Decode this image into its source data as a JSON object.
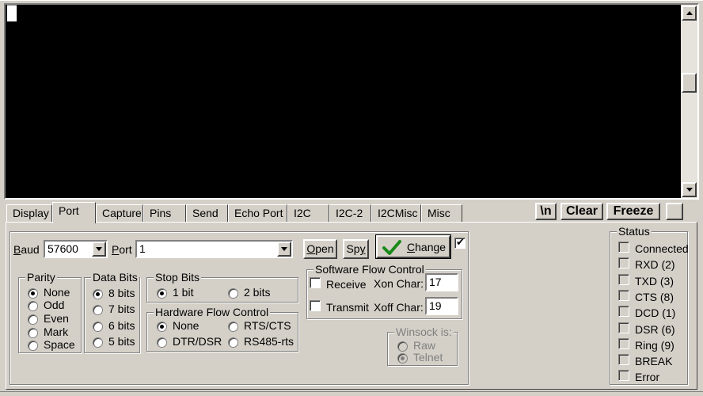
{
  "terminal": {
    "cursor": "█"
  },
  "tabs": [
    "Display",
    "Port",
    "Capture",
    "Pins",
    "Send",
    "Echo Port",
    "I2C",
    "I2C-2",
    "I2CMisc",
    "Misc"
  ],
  "active_tab": "Port",
  "toolbar": {
    "newline": "\\n",
    "clear": "Clear",
    "freeze": "Freeze"
  },
  "port": {
    "baud_label": "Baud",
    "baud_value": "57600",
    "port_label": "Port",
    "port_value": "1",
    "open_label": "Open",
    "spy_label": "Spy",
    "change_label": "Change",
    "change_checked": true
  },
  "parity": {
    "title": "Parity",
    "options": [
      "None",
      "Odd",
      "Even",
      "Mark",
      "Space"
    ],
    "selected": "None"
  },
  "data_bits": {
    "title": "Data Bits",
    "options": [
      "8 bits",
      "7 bits",
      "6 bits",
      "5 bits"
    ],
    "selected": "8 bits"
  },
  "stop_bits": {
    "title": "Stop Bits",
    "options": [
      "1 bit",
      "2 bits"
    ],
    "selected": "1 bit"
  },
  "hw_flow": {
    "title": "Hardware Flow Control",
    "options": [
      "None",
      "RTS/CTS",
      "DTR/DSR",
      "RS485-rts"
    ],
    "selected": "None"
  },
  "sw_flow": {
    "title": "Software Flow Control",
    "receive_label": "Receive",
    "transmit_label": "Transmit",
    "xon_label": "Xon Char:",
    "xon_value": "17",
    "xoff_label": "Xoff Char:",
    "xoff_value": "19"
  },
  "winsock": {
    "title": "Winsock is:",
    "options": [
      "Raw",
      "Telnet"
    ],
    "selected": "Telnet"
  },
  "status": {
    "title": "Status",
    "items": [
      "Connected",
      "RXD (2)",
      "TXD (3)",
      "CTS (8)",
      "DCD (1)",
      "DSR (6)",
      "Ring (9)",
      "BREAK",
      "Error"
    ]
  }
}
